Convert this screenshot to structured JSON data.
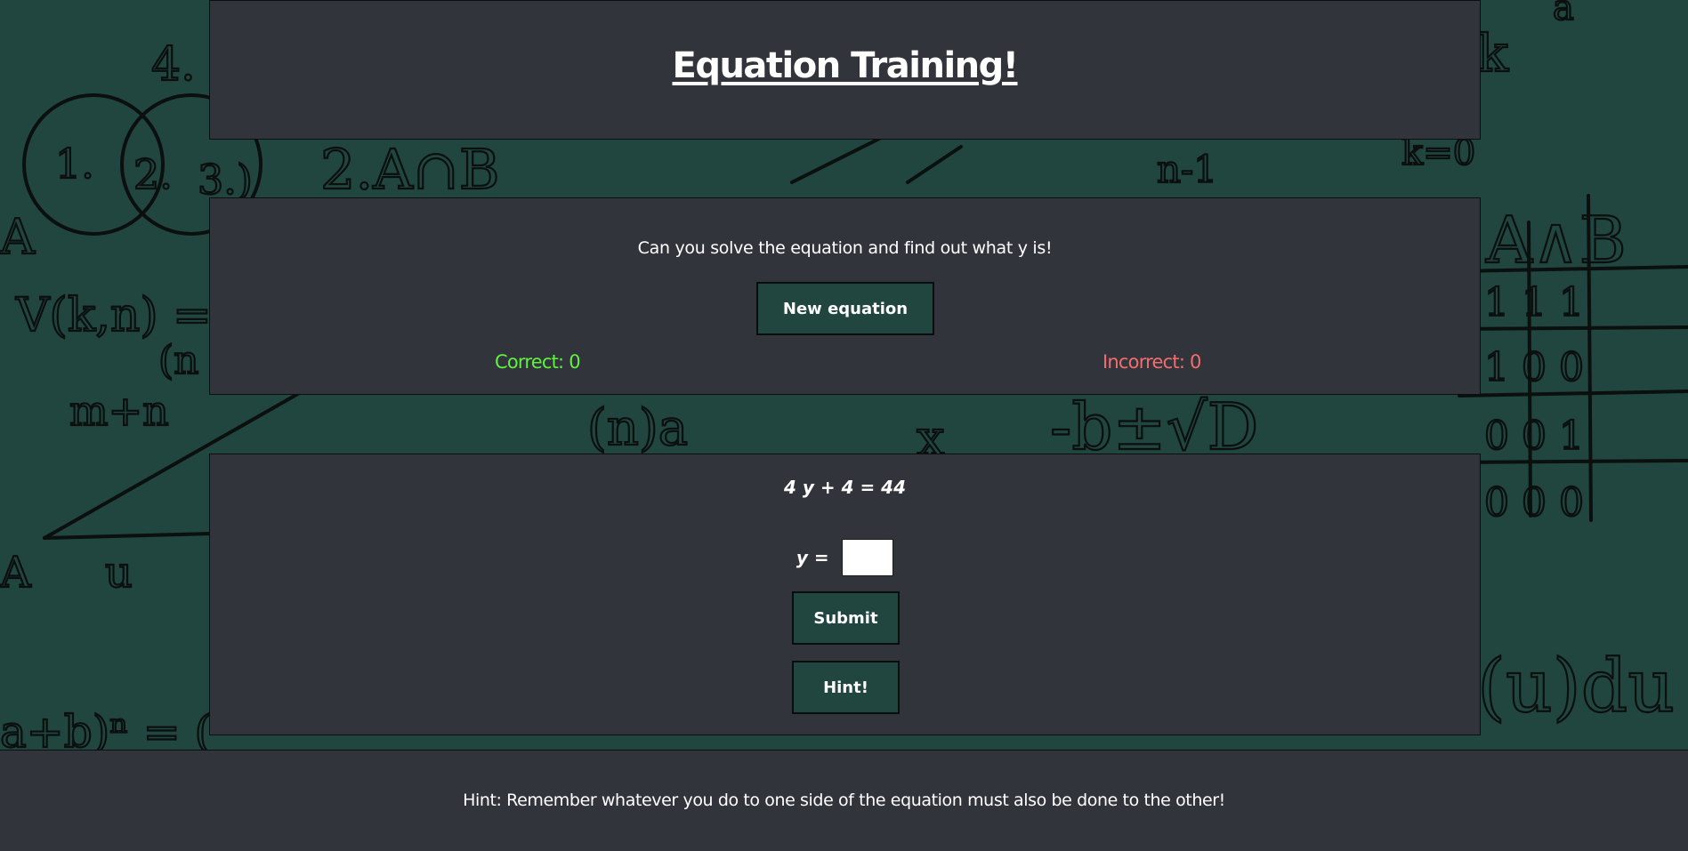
{
  "theme": {
    "background": "#21453f",
    "panel": "#32343c",
    "button": "#21453f",
    "correct": "#5ff23f",
    "incorrect": "#f26e6e"
  },
  "header": {
    "title": "Equation Training!"
  },
  "stats": {
    "instructions": "Can you solve the equation and find out what y is!",
    "new_equation_label": "New equation",
    "correct_label": "Correct: 0",
    "incorrect_label": "Incorrect: 0"
  },
  "equation": {
    "expression": "4 y + 4 = 44",
    "answer_label": "y =",
    "answer_value": "",
    "submit_label": "Submit",
    "hint_label": "Hint!"
  },
  "footer": {
    "hint_text": "Hint: Remember whatever you do to one side of the equation must also be done to the other!"
  }
}
